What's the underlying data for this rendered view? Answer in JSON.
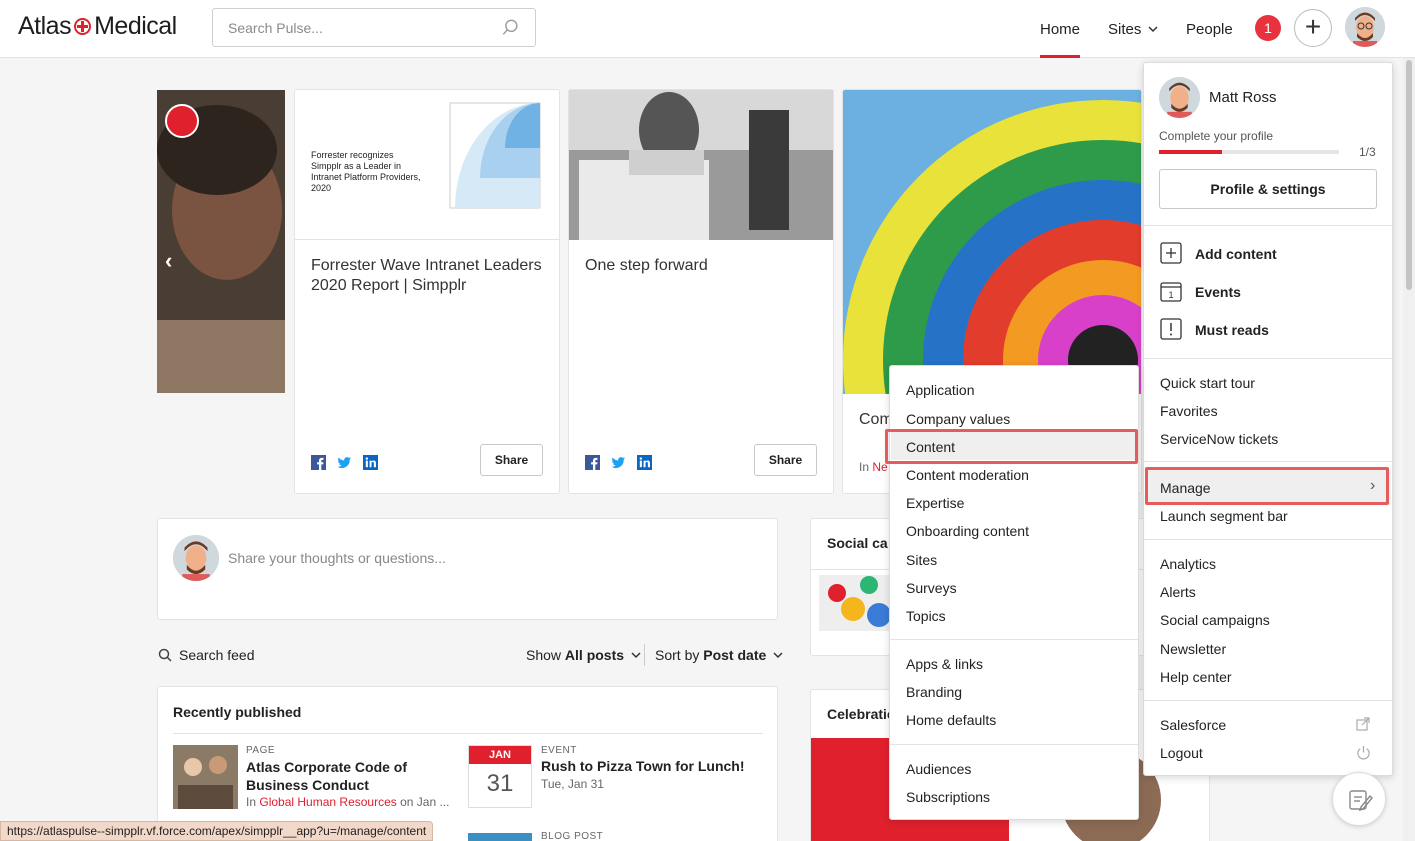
{
  "header": {
    "logo_left": "Atlas",
    "logo_right": "Medical",
    "search_placeholder": "Search Pulse...",
    "nav_home": "Home",
    "nav_sites": "Sites",
    "nav_people": "People",
    "notification_count": "1"
  },
  "carousel": {
    "cards": [
      {
        "title": "Forrester Wave Intranet Leaders 2020 Report | Simpplr",
        "share": "Share",
        "thumb_text": "Forrester recognizes Simpplr as a Leader in Intranet Platform Providers, 2020"
      },
      {
        "title": "One step forward",
        "share": "Share"
      },
      {
        "title_partial": "Com",
        "meta_partial": "In",
        "meta_link_partial": "Ne"
      }
    ]
  },
  "feed": {
    "composer_placeholder": "Share your thoughts or questions...",
    "search_feed": "Search feed",
    "show_prefix": "Show",
    "show_value": "All posts",
    "sort_prefix": "Sort by",
    "sort_value": "Post date"
  },
  "recent": {
    "heading": "Recently published",
    "items": [
      {
        "type": "PAGE",
        "title": "Atlas Corporate Code of Business Conduct",
        "meta_prefix": "In",
        "meta_link": "Global Human Resources",
        "meta_suffix": "on Jan ..."
      },
      {
        "type": "EVENT",
        "title": "Rush to Pizza Town for Lunch!",
        "meta": "Tue, Jan 31",
        "month": "JAN",
        "day": "31"
      },
      {
        "type": "BLOG POST"
      }
    ]
  },
  "side_widgets": {
    "social_partial": "Social ca",
    "celebrations_partial": "Celebratio"
  },
  "profile_menu": {
    "name": "Matt Ross",
    "complete_label": "Complete your profile",
    "progress_text": "1/3",
    "progress_fraction": 0.333,
    "profile_settings": "Profile & settings",
    "primary": [
      "Add content",
      "Events",
      "Must reads"
    ],
    "secondary": [
      "Quick start tour",
      "Favorites",
      "ServiceNow tickets"
    ],
    "manage": "Manage",
    "launch": "Launch segment bar",
    "tertiary": [
      "Analytics",
      "Alerts",
      "Social campaigns",
      "Newsletter",
      "Help center"
    ],
    "salesforce": "Salesforce",
    "logout": "Logout"
  },
  "manage_submenu": {
    "group1": [
      "Application",
      "Company values",
      "Content",
      "Content moderation",
      "Expertise",
      "Onboarding content",
      "Sites",
      "Surveys",
      "Topics"
    ],
    "group2": [
      "Apps & links",
      "Branding",
      "Home defaults"
    ],
    "group3": [
      "Audiences",
      "Subscriptions"
    ]
  },
  "status_bar": "https://atlaspulse--simpplr.vf.force.com/apex/simpplr__app?u=/manage/content",
  "colors": {
    "accent": "#e0202d",
    "highlight": "#e45c5c",
    "link_blue": "#1a66b3"
  }
}
